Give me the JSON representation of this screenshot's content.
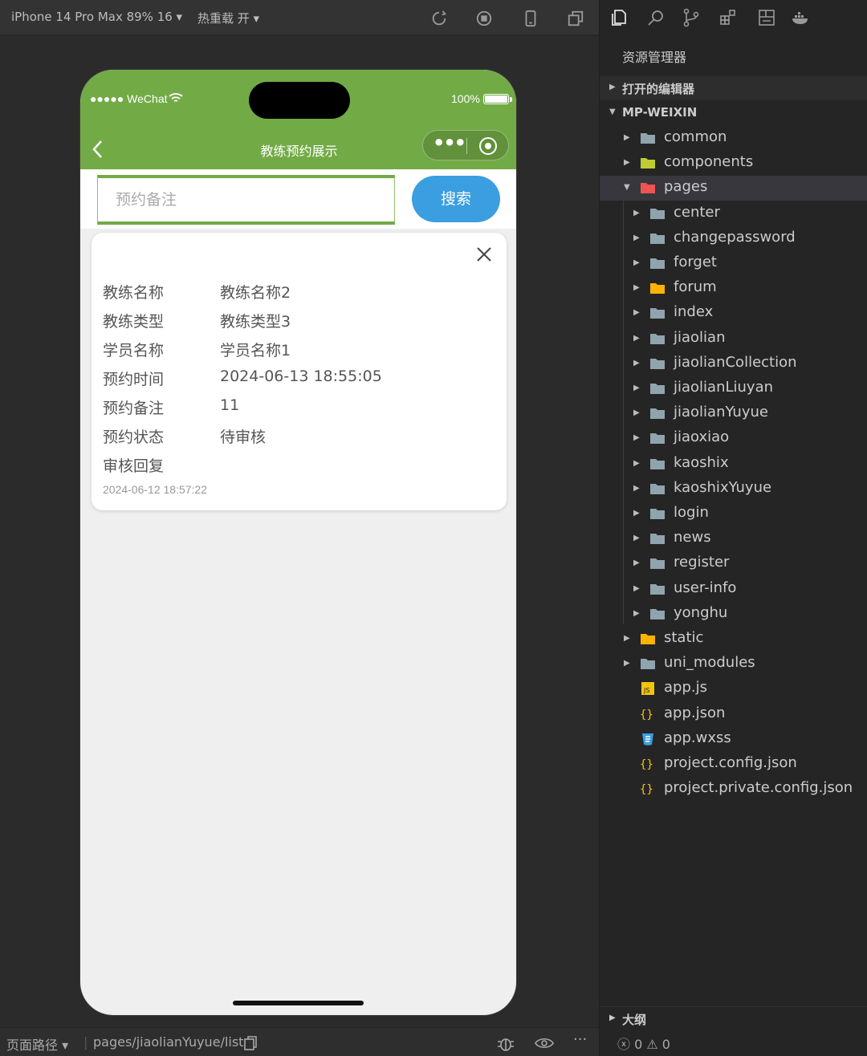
{
  "toolbar": {
    "device_label": "iPhone 14 Pro Max 89% 16 ▾",
    "hot_reload_label": "热重载 开 ▾"
  },
  "phone": {
    "status": {
      "carrier": "●●●●● WeChat",
      "battery": "100%"
    },
    "nav_title": "教练预约展示",
    "search": {
      "placeholder": "预约备注",
      "button_label": "搜索"
    },
    "card": {
      "rows": [
        {
          "label": "教练名称",
          "value": "教练名称2"
        },
        {
          "label": "教练类型",
          "value": "教练类型3"
        },
        {
          "label": "学员名称",
          "value": "学员名称1"
        },
        {
          "label": "预约时间",
          "value": "2024-06-13 18:55:05"
        },
        {
          "label": "预约备注",
          "value": "11"
        },
        {
          "label": "预约状态",
          "value": "待审核"
        },
        {
          "label": "审核回复",
          "value": ""
        }
      ],
      "timestamp": "2024-06-12 18:57:22"
    }
  },
  "bottom_bar": {
    "path_label": "页面路径 ▾",
    "path_value": "pages/jiaolianYuyue/list"
  },
  "explorer": {
    "title": "资源管理器",
    "open_editors": "打开的编辑器",
    "project": "MP-WEIXIN",
    "tree": [
      {
        "name": "common",
        "type": "folder",
        "depth": 1
      },
      {
        "name": "components",
        "type": "folder",
        "depth": 1
      },
      {
        "name": "pages",
        "type": "folder-open",
        "depth": 1
      },
      {
        "name": "center",
        "type": "folder",
        "depth": 2
      },
      {
        "name": "changepassword",
        "type": "folder",
        "depth": 2
      },
      {
        "name": "forget",
        "type": "folder",
        "depth": 2
      },
      {
        "name": "forum",
        "type": "folder",
        "depth": 2
      },
      {
        "name": "index",
        "type": "folder",
        "depth": 2
      },
      {
        "name": "jiaolian",
        "type": "folder",
        "depth": 2
      },
      {
        "name": "jiaolianCollection",
        "type": "folder",
        "depth": 2
      },
      {
        "name": "jiaolianLiuyan",
        "type": "folder",
        "depth": 2
      },
      {
        "name": "jiaolianYuyue",
        "type": "folder",
        "depth": 2
      },
      {
        "name": "jiaoxiao",
        "type": "folder",
        "depth": 2
      },
      {
        "name": "kaoshix",
        "type": "folder",
        "depth": 2
      },
      {
        "name": "kaoshixYuyue",
        "type": "folder",
        "depth": 2
      },
      {
        "name": "login",
        "type": "folder",
        "depth": 2
      },
      {
        "name": "news",
        "type": "folder",
        "depth": 2
      },
      {
        "name": "register",
        "type": "folder",
        "depth": 2
      },
      {
        "name": "user-info",
        "type": "folder",
        "depth": 2
      },
      {
        "name": "yonghu",
        "type": "folder",
        "depth": 2
      },
      {
        "name": "static",
        "type": "folder",
        "depth": 1
      },
      {
        "name": "uni_modules",
        "type": "folder",
        "depth": 1
      },
      {
        "name": "app.js",
        "type": "js",
        "depth": 1
      },
      {
        "name": "app.json",
        "type": "json",
        "depth": 1
      },
      {
        "name": "app.wxss",
        "type": "css",
        "depth": 1
      },
      {
        "name": "project.config.json",
        "type": "json",
        "depth": 1
      },
      {
        "name": "project.private.config.json",
        "type": "json",
        "depth": 1
      }
    ],
    "outline": "大纲",
    "problems": "ⓧ 0 ⚠ 0"
  },
  "colors": {
    "header_green": "#72ab45",
    "search_blue": "#3b9ee0",
    "folder_grey": "#90a4ae",
    "components_yellow": "#c0ca33",
    "pages_red": "#ef5350",
    "static_orange": "#ffb300"
  }
}
